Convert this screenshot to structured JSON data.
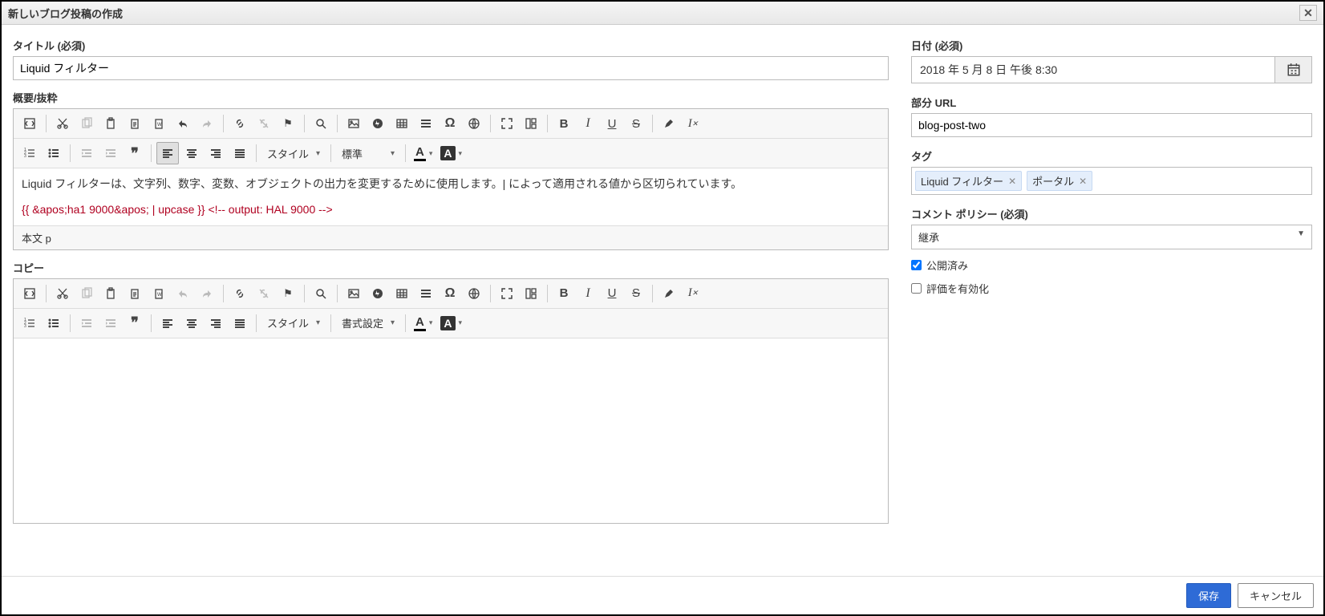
{
  "dialog_title": "新しいブログ投稿の作成",
  "left": {
    "title_label": "タイトル (必須)",
    "title_value": "Liquid フィルター",
    "summary_label": "概要/抜粋",
    "summary_text": "Liquid フィルターは、文字列、数字、変数、オブジェクトの出力を変更するために使用します。| によって適用される値から区切られています。",
    "summary_code": "{{ &apos;ha1 9000&apos; | upcase }} <!-- output: HAL 9000 -->",
    "summary_status": "本文 p",
    "copy_label": "コピー"
  },
  "toolbar": {
    "style_label": "スタイル",
    "format_label_1": "標準",
    "format_label_2": "書式設定"
  },
  "right": {
    "date_label": "日付 (必須)",
    "date_value": "2018 年 5 月 8 日 午後 8:30",
    "url_label": "部分 URL",
    "url_value": "blog-post-two",
    "tag_label": "タグ",
    "tags": [
      "Liquid フィルター",
      "ポータル"
    ],
    "policy_label": "コメント ポリシー (必須)",
    "policy_value": "継承",
    "published_label": "公開済み",
    "rating_label": "評価を有効化"
  },
  "footer": {
    "save": "保存",
    "cancel": "キャンセル"
  }
}
